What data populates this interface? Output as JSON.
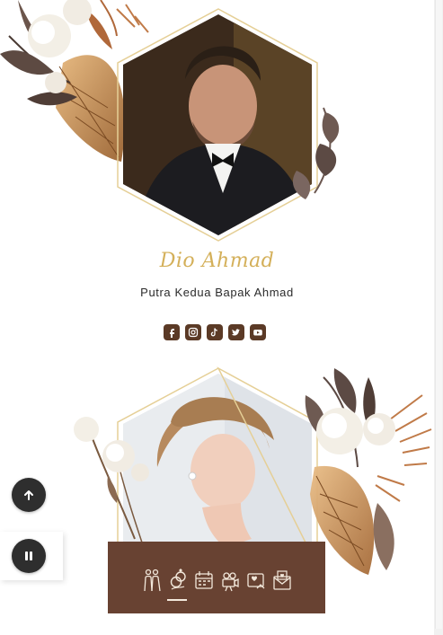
{
  "groom": {
    "name": "Dio Ahmad",
    "subtitle": "Putra Kedua Bapak Ahmad",
    "social_icons": [
      "facebook-icon",
      "instagram-icon",
      "tiktok-icon",
      "twitter-icon",
      "youtube-icon"
    ]
  },
  "floating": {
    "scroll_top_icon": "arrow-up-icon",
    "music_icon": "pause-icon"
  },
  "bottom_nav": {
    "items": [
      "couple-icon",
      "rings-icon",
      "calendar-icon",
      "camera-icon",
      "gallery-icon",
      "envelope-icon"
    ],
    "active_index": 1
  },
  "colors": {
    "gold": "#d4b05a",
    "brown": "#684232",
    "social_brown": "#5b3a26",
    "dark_button": "#2e2e2e"
  }
}
